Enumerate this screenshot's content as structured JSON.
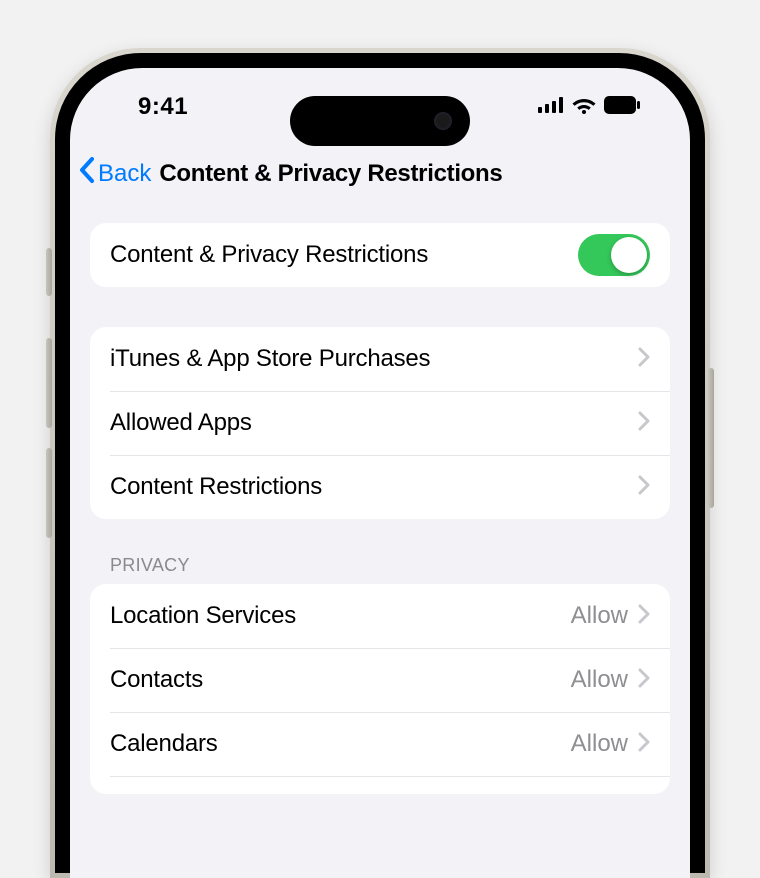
{
  "status": {
    "time": "9:41"
  },
  "nav": {
    "back_label": "Back",
    "title": "Content & Privacy Restrictions"
  },
  "toggle_row": {
    "label": "Content & Privacy Restrictions",
    "enabled": true
  },
  "group1": {
    "items": [
      {
        "label": "iTunes & App Store Purchases"
      },
      {
        "label": "Allowed Apps"
      },
      {
        "label": "Content Restrictions"
      }
    ]
  },
  "privacy_header": "Privacy",
  "privacy": {
    "items": [
      {
        "label": "Location Services",
        "value": "Allow"
      },
      {
        "label": "Contacts",
        "value": "Allow"
      },
      {
        "label": "Calendars",
        "value": "Allow"
      }
    ]
  }
}
